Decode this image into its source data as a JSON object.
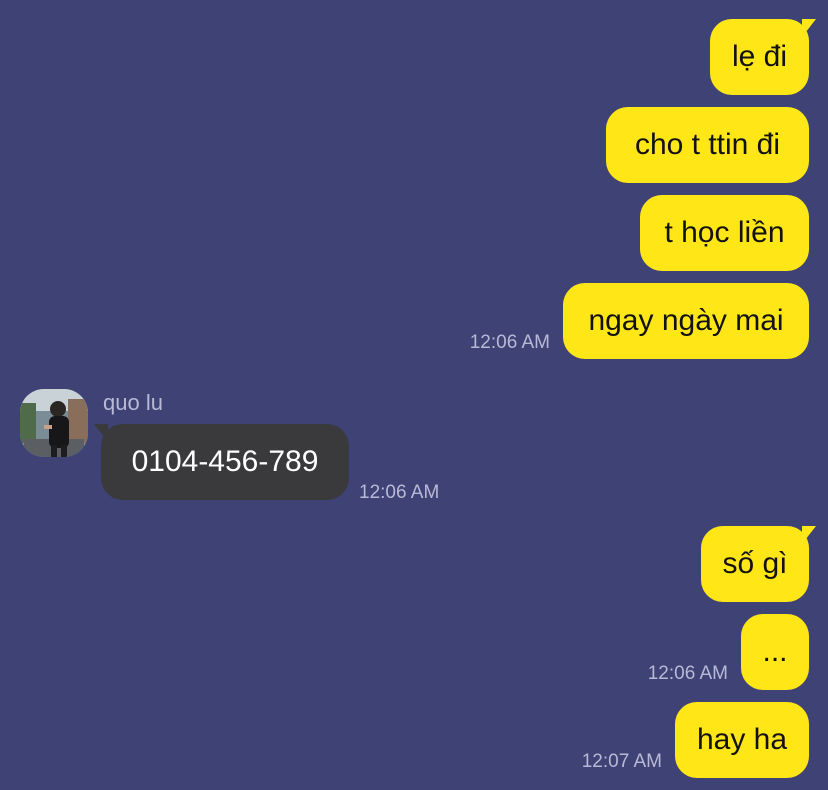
{
  "conversation": {
    "contact_name": "quo lu",
    "messages": [
      {
        "from": "me",
        "text": "lẹ đi"
      },
      {
        "from": "me",
        "text": "cho t ttin đi"
      },
      {
        "from": "me",
        "text": "t học liền"
      },
      {
        "from": "me",
        "text": "ngay ngày mai",
        "time": "12:06 AM"
      },
      {
        "from": "quo lu",
        "text": "0104-456-789",
        "time": "12:06 AM"
      },
      {
        "from": "me",
        "text": "số gì"
      },
      {
        "from": "me",
        "text": "...",
        "time": "12:06 AM"
      },
      {
        "from": "me",
        "text": "hay ha",
        "time": "12:07 AM"
      }
    ]
  },
  "icons": {
    "avatar": "profile-photo-person"
  },
  "colors": {
    "background": "#3f4275",
    "outgoing_bubble": "#ffe617",
    "incoming_bubble": "#3a3a3d",
    "timestamp": "#b8b9d6",
    "sender_name": "#b8b9d6"
  }
}
